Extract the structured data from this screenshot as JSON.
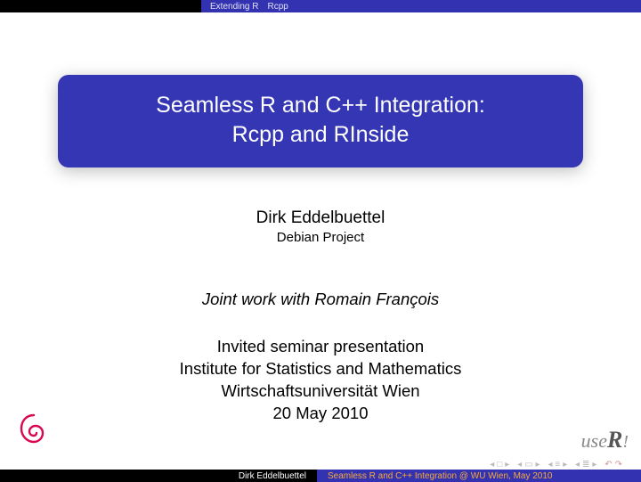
{
  "topbar": {
    "section1": "Extending R",
    "section2": "Rcpp"
  },
  "title": {
    "line1": "Seamless R and C++ Integration:",
    "line2": "Rcpp and RInside"
  },
  "author": "Dirk Eddelbuettel",
  "affiliation": "Debian Project",
  "joint": "Joint work with Romain François",
  "seminar": {
    "line1": "Invited seminar presentation",
    "line2": "Institute for Statistics and Mathematics",
    "line3": "Wirtschaftsuniversität Wien",
    "line4": "20 May 2010"
  },
  "userlogo": {
    "prefix": "use",
    "r": "R",
    "bang": "!"
  },
  "footer": {
    "author": "Dirk Eddelbuettel",
    "title": "Seamless R and C++ Integration @ WU Wien, May 2010"
  }
}
